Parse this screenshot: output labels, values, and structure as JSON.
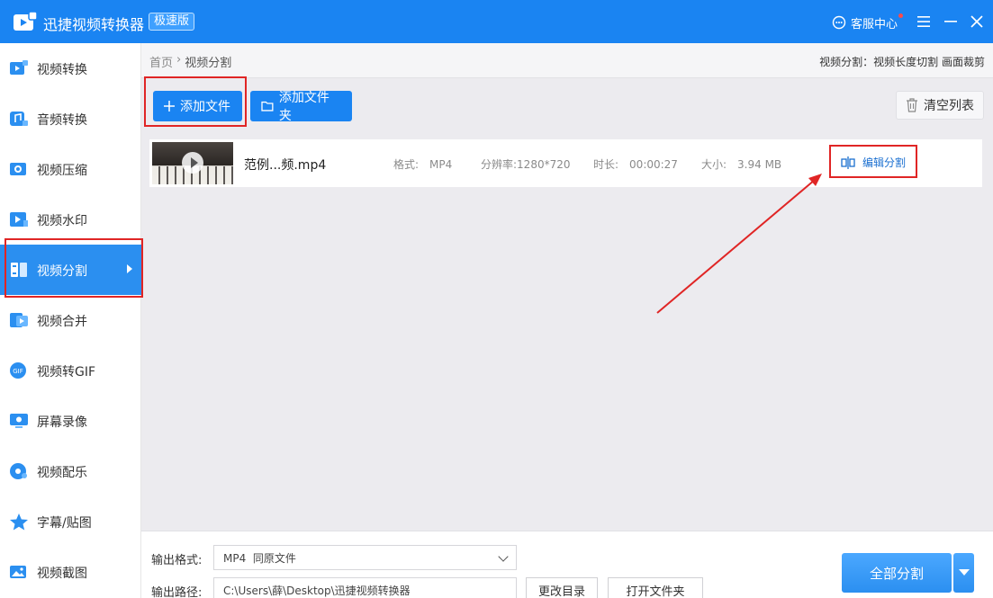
{
  "app": {
    "title": "迅捷视频转换器",
    "edition": "极速版",
    "service_label": "客服中心",
    "icons": [
      "app-logo",
      "headset-icon",
      "menu-icon",
      "minimize-icon",
      "close-icon"
    ]
  },
  "sidebar": {
    "items": [
      {
        "label": "视频转换",
        "icon": "video-convert-icon"
      },
      {
        "label": "音频转换",
        "icon": "audio-convert-icon"
      },
      {
        "label": "视频压缩",
        "icon": "video-compress-icon"
      },
      {
        "label": "视频水印",
        "icon": "video-watermark-icon"
      },
      {
        "label": "视频分割",
        "icon": "video-split-icon",
        "active": true
      },
      {
        "label": "视频合并",
        "icon": "video-merge-icon"
      },
      {
        "label": "视频转GIF",
        "icon": "gif-icon"
      },
      {
        "label": "屏幕录像",
        "icon": "screen-record-icon"
      },
      {
        "label": "视频配乐",
        "icon": "music-icon"
      },
      {
        "label": "字幕/贴图",
        "icon": "sticker-icon"
      },
      {
        "label": "视频截图",
        "icon": "screenshot-icon"
      }
    ]
  },
  "breadcrumb": {
    "home": "首页",
    "separator": "›",
    "current": "视频分割"
  },
  "mode_info": "视频分割：视频长度切割 画面裁剪",
  "toolbar": {
    "add_file": "添加文件",
    "add_folder": "添加文件夹",
    "clear_list": "清空列表"
  },
  "file": {
    "name": "范例...频.mp4",
    "format_label": "格式:",
    "format_value": "MP4",
    "resolution_label": "分辨率:",
    "resolution_value": "1280*720",
    "duration_label": "时长:",
    "duration_value": "00:00:27",
    "size_label": "大小:",
    "size_value": "3.94 MB",
    "edit_label": "编辑分割"
  },
  "bottom": {
    "format_label": "输出格式:",
    "format_value": "MP4  同原文件",
    "path_label": "输出路径:",
    "path_value": "C:\\Users\\薛\\Desktop\\迅捷视频转换器",
    "change_dir": "更改目录",
    "open_folder": "打开文件夹",
    "split_all": "全部分割"
  },
  "colors": {
    "brand": "#1a84f2",
    "active_nav": "#2b8ff0",
    "highlight": "#e02525"
  }
}
